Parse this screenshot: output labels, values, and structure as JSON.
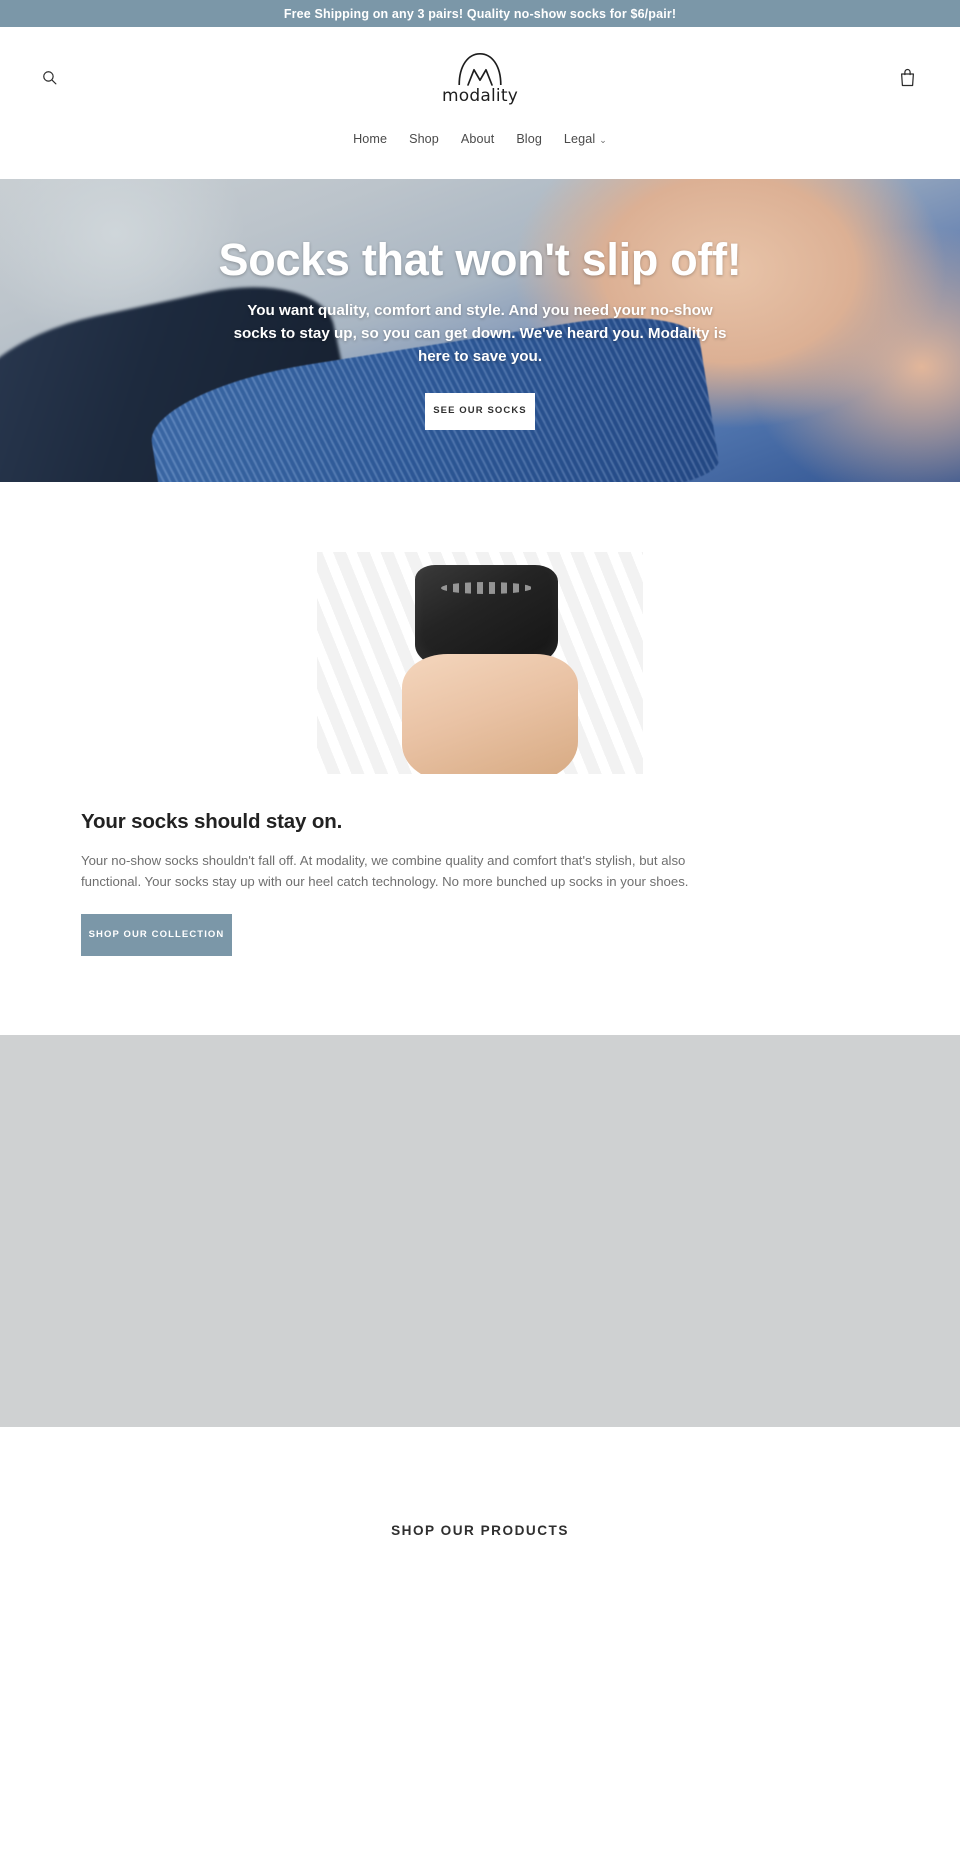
{
  "announcement": {
    "text": "Free Shipping on any 3 pairs! Quality no-show socks for $6/pair!",
    "background": "#7b97a8",
    "color": "#ffffff"
  },
  "header": {
    "search_icon": "search-icon",
    "cart_icon": "shopping-bag-icon",
    "logo_wordmark": "modality",
    "logo_mark": "mountain-peaks-icon"
  },
  "nav": {
    "items": [
      {
        "label": "Home",
        "has_dropdown": false
      },
      {
        "label": "Shop",
        "has_dropdown": false
      },
      {
        "label": "About",
        "has_dropdown": false
      },
      {
        "label": "Blog",
        "has_dropdown": false
      },
      {
        "label": "Legal",
        "has_dropdown": true
      }
    ],
    "caret": "⌄"
  },
  "hero": {
    "title": "Socks that won't slip off!",
    "subtitle": "You want quality, comfort and style. And you need your no-show socks to stay up, so you can get down. We've heard you. Modality is here to save you.",
    "button_label": "SEE OUR SOCKS"
  },
  "feature": {
    "image_alt": "no-show-sock-on-hand-photo",
    "heading": "Your socks should stay on.",
    "body": "Your no-show socks shouldn't fall off. At modality, we combine quality and comfort that's stylish, but also functional. Your socks stay up with our heel catch technology. No more bunched up socks in your shoes.",
    "button_label": "SHOP OUR COLLECTION",
    "button_color": "#7b97a8"
  },
  "media_block": {
    "placeholder_color": "#cfd1d2"
  },
  "products": {
    "title": "SHOP OUR PRODUCTS"
  }
}
